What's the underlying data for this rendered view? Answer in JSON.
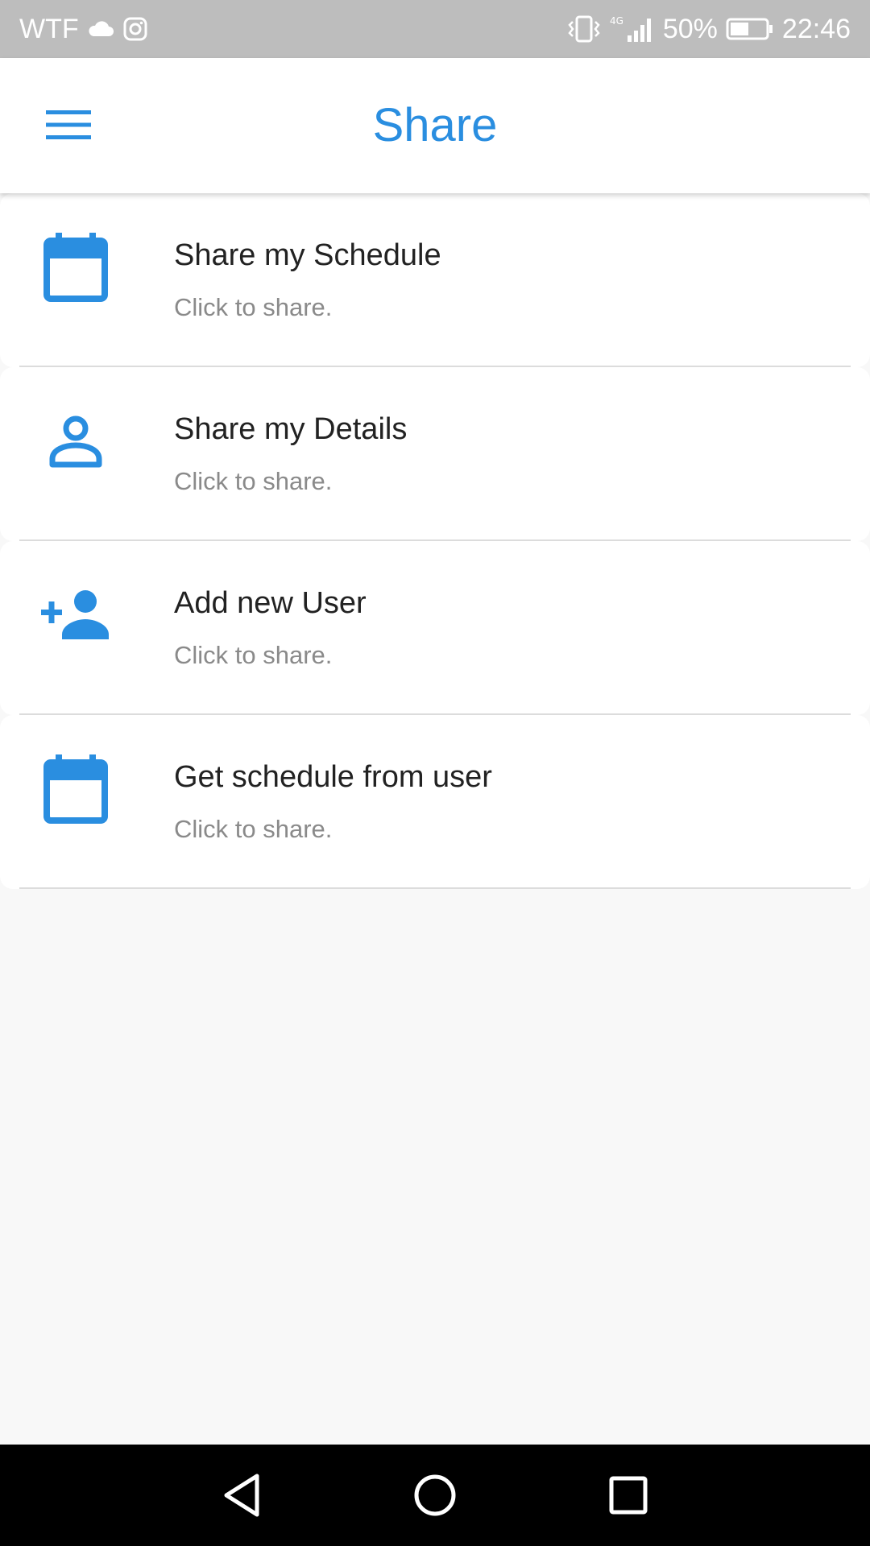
{
  "status_bar": {
    "carrier": "WTF",
    "battery_percent": "50%",
    "time": "22:46",
    "network": "4G",
    "icons": [
      "cloud-icon",
      "instagram-icon",
      "vibrate-icon",
      "signal-icon",
      "battery-icon"
    ]
  },
  "app_bar": {
    "title": "Share",
    "menu_icon": "hamburger-menu-icon"
  },
  "colors": {
    "accent": "#2a8ee0",
    "status_bar": "#bdbdbd",
    "background": "#f8f8f8",
    "title_text": "#222222",
    "subtitle_text": "#8a8a8a"
  },
  "items": [
    {
      "icon": "calendar-icon",
      "title": "Share my Schedule",
      "subtitle": "Click to share."
    },
    {
      "icon": "person-icon",
      "title": "Share my Details",
      "subtitle": "Click to share."
    },
    {
      "icon": "add-person-icon",
      "title": "Add new User",
      "subtitle": "Click to share."
    },
    {
      "icon": "calendar-icon",
      "title": "Get schedule from user",
      "subtitle": "Click to share."
    }
  ],
  "nav_bar": {
    "buttons": [
      "back-triangle-icon",
      "home-circle-icon",
      "recents-square-icon"
    ]
  }
}
